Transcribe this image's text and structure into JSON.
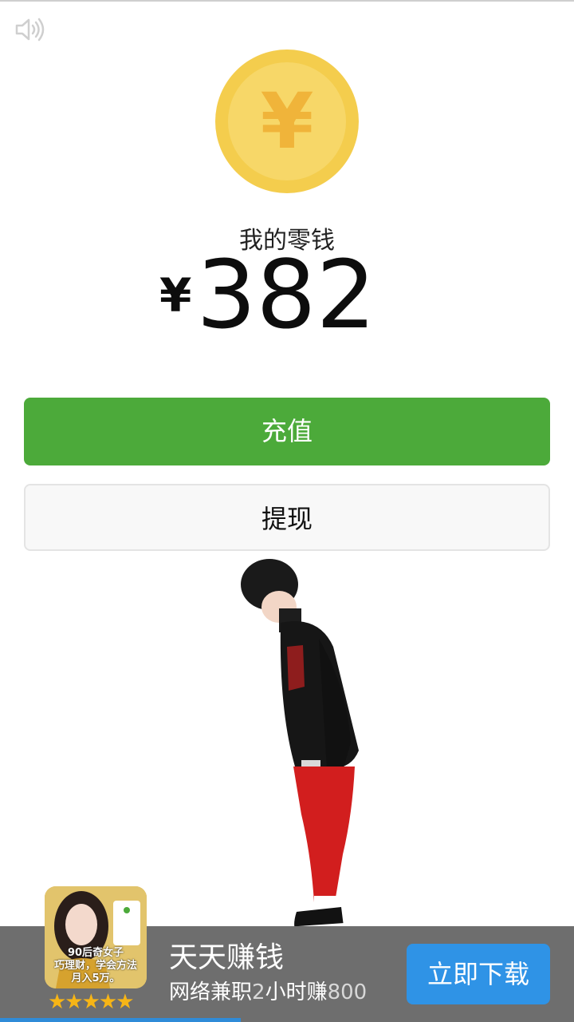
{
  "wallet": {
    "title": "我的零钱",
    "currency_symbol": "¥",
    "amount": "382",
    "coin_symbol": "¥"
  },
  "buttons": {
    "recharge": "充值",
    "withdraw": "提现"
  },
  "ad": {
    "thumbnail_caption_line1": "90后奇女子",
    "thumbnail_caption_line2": "巧理财，学会方法",
    "thumbnail_caption_line3": "月入5万。",
    "rating_stars": "★★★★★",
    "title": "天天赚钱",
    "subtitle_part1": "网络兼职",
    "subtitle_part2": "2",
    "subtitle_part3": "小时赚",
    "subtitle_part4": "800",
    "download_label": "立即下载",
    "progress": 0.42
  },
  "colors": {
    "green": "#4caa3a",
    "coin": "#f4cd4d",
    "download": "#2f93e6",
    "adbar": "#6e6e6e"
  },
  "icons": [
    "speaker-icon",
    "coin-icon",
    "star-icon"
  ]
}
